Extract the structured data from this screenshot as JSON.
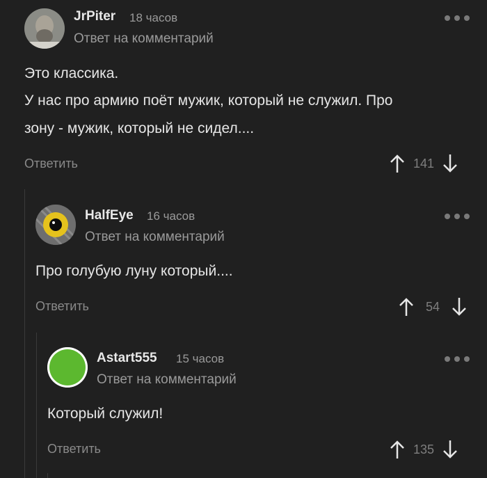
{
  "comments": [
    {
      "author": "JrPiter",
      "time": "18 часов",
      "reply_label": "Ответ на комментарий",
      "lines": [
        "Это классика.",
        "У нас про армию поёт мужик, который не служил. Про",
        "зону - мужик, который не сидел...."
      ],
      "reply_button": "Ответить",
      "score": "141"
    },
    {
      "author": "HalfEye",
      "time": "16 часов",
      "reply_label": "Ответ на комментарий",
      "lines": [
        "Про голубую луну который...."
      ],
      "reply_button": "Ответить",
      "score": "54"
    },
    {
      "author": "Astart555",
      "time": "15 часов",
      "reply_label": "Ответ на комментарий",
      "lines": [
        "Который служил!"
      ],
      "reply_button": "Ответить",
      "score": "135"
    }
  ],
  "icons": {
    "more": "more-dots-icon",
    "upvote": "arrow-up-icon",
    "downvote": "arrow-down-icon"
  },
  "colors": {
    "background": "#202020",
    "avatar_green": "#5cb82f"
  }
}
